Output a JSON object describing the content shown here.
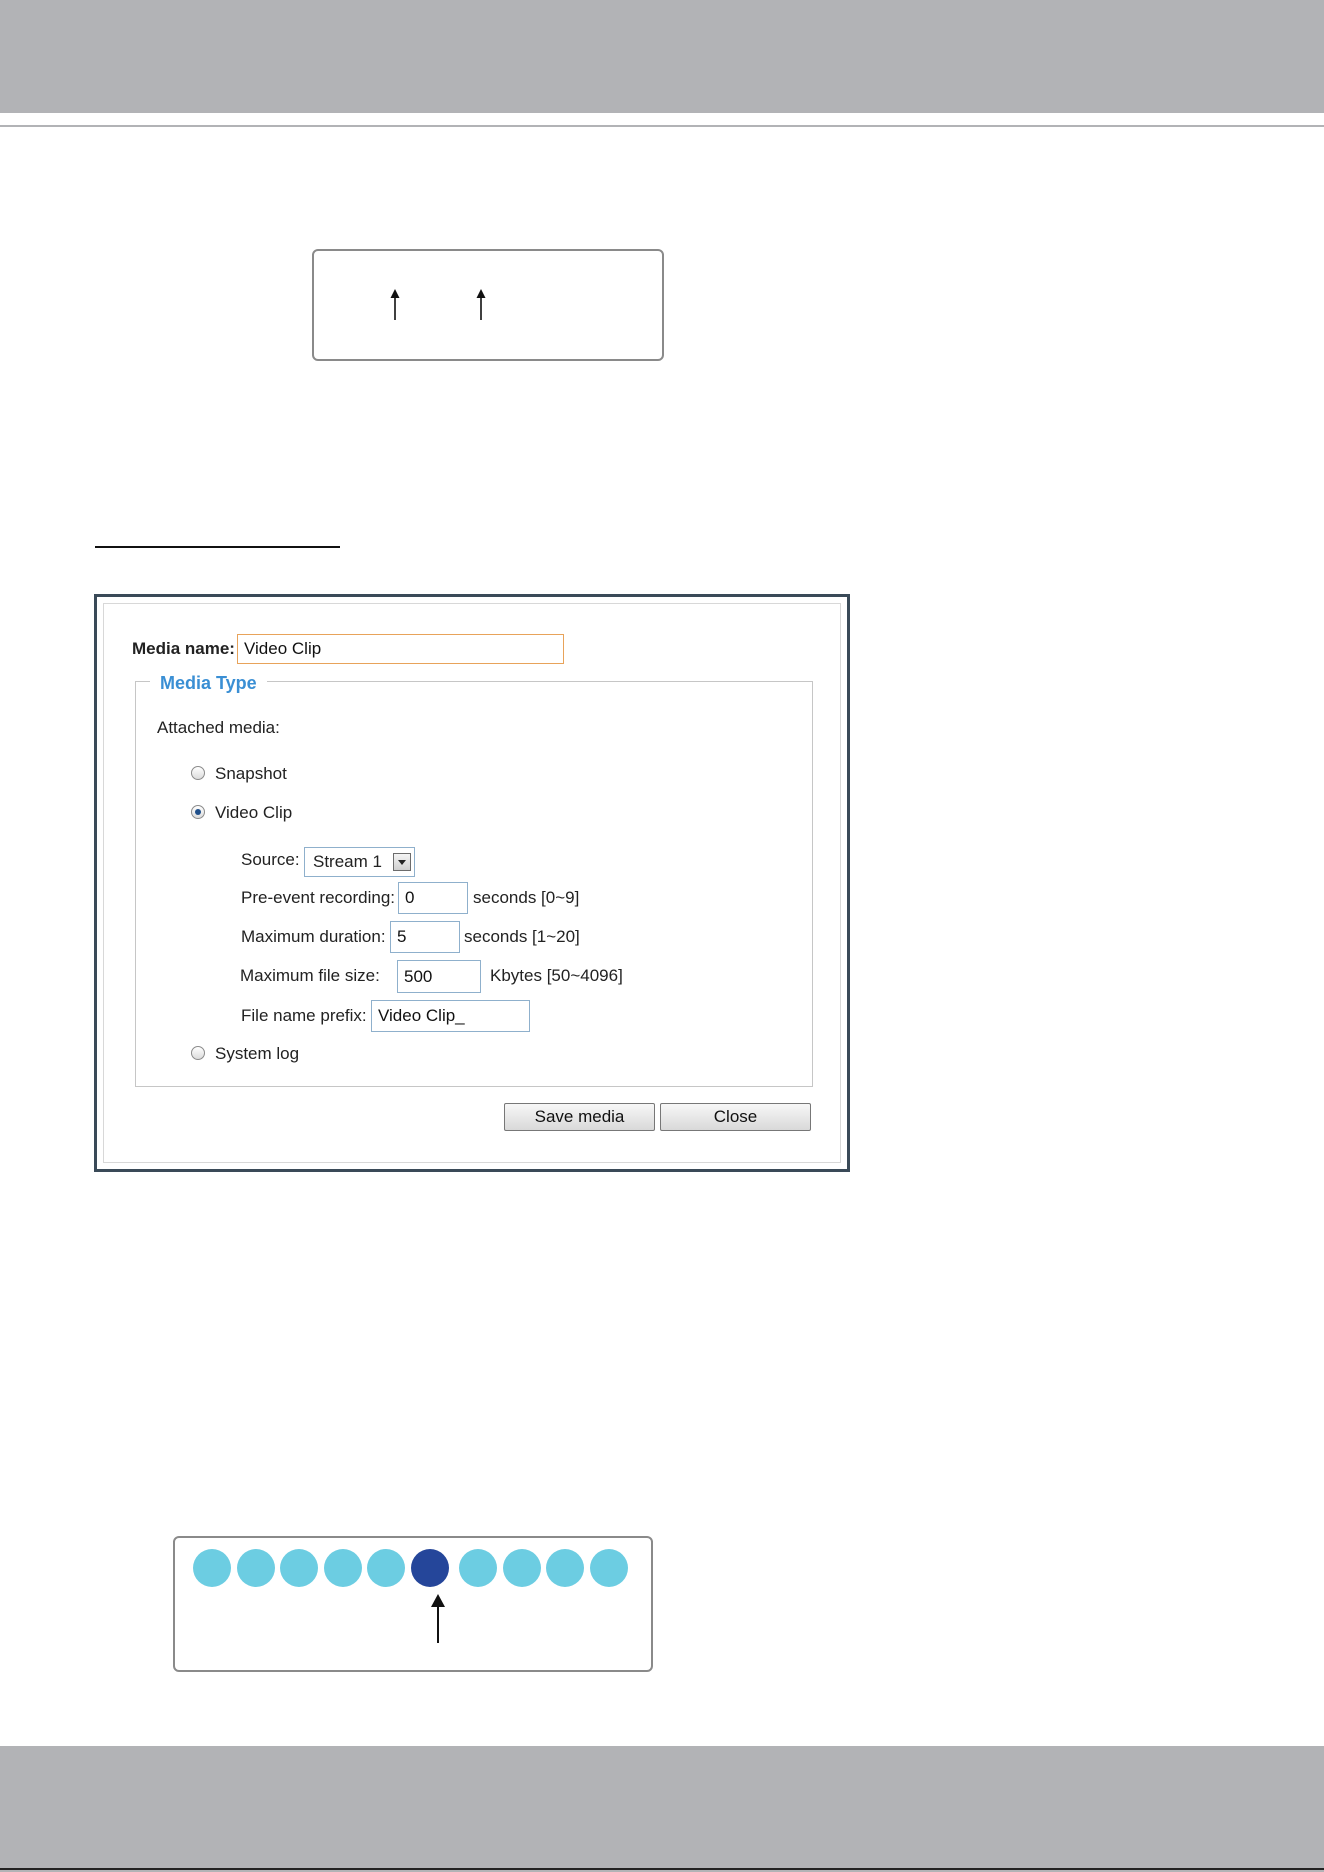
{
  "colors": {
    "band": "#b2b3b6",
    "dot_inactive": "#6ccde2",
    "dot_active": "#25469a",
    "legend": "#3a8fd4"
  },
  "dialog": {
    "media_name_label": "Media name:",
    "media_name_value": "Video Clip",
    "media_type_legend": "Media Type",
    "attached_media_label": "Attached media:",
    "options": {
      "snapshot": "Snapshot",
      "video_clip": "Video Clip",
      "system_log": "System log"
    },
    "selected_option": "Video Clip",
    "source": {
      "label": "Source:",
      "value": "Stream 1"
    },
    "pre_event": {
      "label": "Pre-event recording:",
      "value": "0",
      "unit": "seconds [0~9]"
    },
    "max_duration": {
      "label": "Maximum duration:",
      "value": "5",
      "unit": "seconds [1~20]"
    },
    "max_file_size": {
      "label": "Maximum file size:",
      "value": "500",
      "unit": "Kbytes [50~4096]"
    },
    "file_name_prefix": {
      "label": "File name prefix:",
      "value": "Video Clip_"
    },
    "buttons": {
      "save": "Save media",
      "close": "Close"
    }
  },
  "dot_diagram": {
    "count": 10,
    "active_index": 5
  }
}
